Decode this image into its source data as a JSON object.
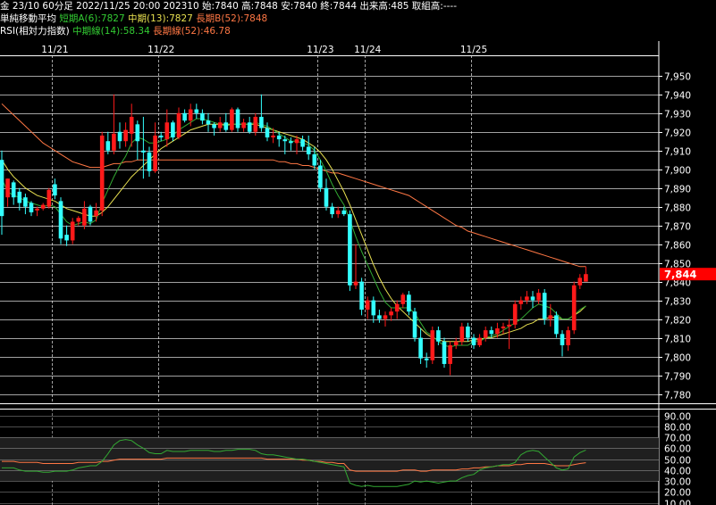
{
  "header": {
    "line1": "金 23/10 60分足 2022/11/25 20:00 202310 始:7840 高:7848 安:7840 終:7844 出来高:485 取組高:----",
    "line2_label": "単純移動平均",
    "line2_short": "短期A(6):7827",
    "line2_mid": "中期(13):7827",
    "line2_long": "長期B(52):7848",
    "line3_label": "RSI(相対力指数)",
    "line3_mid": "中期線(14):58.34",
    "line3_long": "長期線(52):46.78"
  },
  "colors": {
    "up": "#ff1a1a",
    "down": "#33ffff",
    "ma_short": "#33aa33",
    "ma_mid": "#e8e050",
    "ma_long": "#ff7744",
    "rsi_mid": "#33aa33",
    "rsi_long": "#ff7744",
    "last_price_bg": "#ff0000",
    "grid": "#ffffff"
  },
  "chart_data": {
    "type": "candlestick",
    "x_labels": [
      "11/21",
      "11/22",
      "11/23",
      "11/24",
      "11/25"
    ],
    "x_label_bars": [
      9,
      27,
      54,
      62,
      80
    ],
    "date_boundary_bars": [
      0,
      9,
      27,
      54,
      62,
      80
    ],
    "y_ticks": [
      7780,
      7790,
      7800,
      7810,
      7820,
      7830,
      7840,
      7850,
      7860,
      7870,
      7880,
      7890,
      7900,
      7910,
      7920,
      7930,
      7940,
      7950
    ],
    "y_tick_labels": [
      "7,780",
      "7,790",
      "7,800",
      "7,810",
      "7,820",
      "7,830",
      "7,840",
      "7,850",
      "7,860",
      "7,870",
      "7,880",
      "7,890",
      "7,900",
      "7,910",
      "7,920",
      "7,930",
      "7,940",
      "7,950"
    ],
    "ylim": [
      7775,
      7958
    ],
    "last_price": 7844,
    "last_price_label": "7,844",
    "candles": [
      [
        7905,
        7910,
        7865,
        7875
      ],
      [
        7885,
        7895,
        7880,
        7895
      ],
      [
        7893,
        7894,
        7881,
        7885
      ],
      [
        7888,
        7890,
        7878,
        7882
      ],
      [
        7885,
        7887,
        7876,
        7880
      ],
      [
        7882,
        7883,
        7875,
        7877
      ],
      [
        7878,
        7880,
        7875,
        7879
      ],
      [
        7879,
        7882,
        7878,
        7881
      ],
      [
        7880,
        7890,
        7879,
        7889
      ],
      [
        7892,
        7895,
        7884,
        7886
      ],
      [
        7883,
        7885,
        7860,
        7863
      ],
      [
        7865,
        7870,
        7859,
        7862
      ],
      [
        7862,
        7874,
        7860,
        7872
      ],
      [
        7872,
        7875,
        7870,
        7874
      ],
      [
        7870,
        7883,
        7868,
        7879
      ],
      [
        7880,
        7881,
        7870,
        7872
      ],
      [
        7875,
        7882,
        7872,
        7878
      ],
      [
        7878,
        7920,
        7875,
        7918
      ],
      [
        7915,
        7920,
        7908,
        7910
      ],
      [
        7910,
        7940,
        7908,
        7919
      ],
      [
        7920,
        7925,
        7911,
        7915
      ],
      [
        7915,
        7925,
        7912,
        7921
      ],
      [
        7919,
        7935,
        7912,
        7928
      ],
      [
        7924,
        7926,
        7905,
        7915
      ],
      [
        7910,
        7928,
        7895,
        7909
      ],
      [
        7909,
        7912,
        7896,
        7899
      ],
      [
        7899,
        7925,
        7898,
        7918
      ],
      [
        7918,
        7920,
        7915,
        7917
      ],
      [
        7916,
        7932,
        7912,
        7925
      ],
      [
        7925,
        7926,
        7915,
        7917
      ],
      [
        7917,
        7933,
        7916,
        7930
      ],
      [
        7930,
        7932,
        7925,
        7926
      ],
      [
        7926,
        7935,
        7923,
        7932
      ],
      [
        7932,
        7935,
        7927,
        7930
      ],
      [
        7930,
        7932,
        7924,
        7926
      ],
      [
        7926,
        7930,
        7920,
        7924
      ],
      [
        7924,
        7925,
        7918,
        7922
      ],
      [
        7922,
        7928,
        7920,
        7925
      ],
      [
        7925,
        7930,
        7920,
        7921
      ],
      [
        7921,
        7933,
        7920,
        7932
      ],
      [
        7932,
        7933,
        7920,
        7922
      ],
      [
        7922,
        7927,
        7920,
        7925
      ],
      [
        7925,
        7928,
        7919,
        7920
      ],
      [
        7920,
        7930,
        7918,
        7928
      ],
      [
        7928,
        7940,
        7920,
        7922
      ],
      [
        7922,
        7925,
        7915,
        7917
      ],
      [
        7917,
        7922,
        7914,
        7918
      ],
      [
        7918,
        7920,
        7912,
        7916
      ],
      [
        7916,
        7918,
        7908,
        7915
      ],
      [
        7915,
        7917,
        7910,
        7914
      ],
      [
        7914,
        7918,
        7908,
        7916
      ],
      [
        7916,
        7918,
        7910,
        7912
      ],
      [
        7912,
        7918,
        7905,
        7908
      ],
      [
        7908,
        7912,
        7900,
        7902
      ],
      [
        7902,
        7905,
        7888,
        7890
      ],
      [
        7890,
        7895,
        7878,
        7880
      ],
      [
        7880,
        7882,
        7874,
        7876
      ],
      [
        7876,
        7880,
        7874,
        7878
      ],
      [
        7878,
        7880,
        7875,
        7876
      ],
      [
        7876,
        7878,
        7835,
        7838
      ],
      [
        7838,
        7860,
        7836,
        7840
      ],
      [
        7840,
        7842,
        7822,
        7825
      ],
      [
        7825,
        7832,
        7820,
        7830
      ],
      [
        7830,
        7832,
        7818,
        7822
      ],
      [
        7822,
        7825,
        7818,
        7820
      ],
      [
        7820,
        7824,
        7816,
        7822
      ],
      [
        7822,
        7826,
        7819,
        7824
      ],
      [
        7824,
        7830,
        7820,
        7828
      ],
      [
        7828,
        7834,
        7826,
        7833
      ],
      [
        7833,
        7835,
        7822,
        7824
      ],
      [
        7824,
        7826,
        7808,
        7810
      ],
      [
        7810,
        7815,
        7796,
        7799
      ],
      [
        7799,
        7802,
        7794,
        7798
      ],
      [
        7798,
        7816,
        7796,
        7814
      ],
      [
        7814,
        7816,
        7806,
        7808
      ],
      [
        7808,
        7810,
        7794,
        7796
      ],
      [
        7796,
        7808,
        7790,
        7806
      ],
      [
        7806,
        7810,
        7804,
        7808
      ],
      [
        7808,
        7818,
        7806,
        7816
      ],
      [
        7816,
        7818,
        7808,
        7810
      ],
      [
        7810,
        7812,
        7804,
        7806
      ],
      [
        7806,
        7812,
        7805,
        7810
      ],
      [
        7810,
        7816,
        7808,
        7814
      ],
      [
        7814,
        7816,
        7810,
        7812
      ],
      [
        7812,
        7818,
        7810,
        7815
      ],
      [
        7815,
        7818,
        7812,
        7816
      ],
      [
        7816,
        7820,
        7804,
        7817
      ],
      [
        7817,
        7830,
        7815,
        7828
      ],
      [
        7828,
        7832,
        7825,
        7830
      ],
      [
        7830,
        7835,
        7828,
        7832
      ],
      [
        7832,
        7835,
        7826,
        7830
      ],
      [
        7830,
        7836,
        7828,
        7834
      ],
      [
        7834,
        7836,
        7817,
        7820
      ],
      [
        7820,
        7828,
        7816,
        7822
      ],
      [
        7822,
        7824,
        7810,
        7812
      ],
      [
        7812,
        7814,
        7800,
        7806
      ],
      [
        7806,
        7816,
        7803,
        7814
      ],
      [
        7814,
        7840,
        7812,
        7838
      ],
      [
        7838,
        7844,
        7836,
        7842
      ],
      [
        7840,
        7848,
        7840,
        7844
      ]
    ],
    "ma_short": [
      7895,
      7888,
      7886,
      7885,
      7883,
      7882,
      7881,
      7880,
      7881,
      7880,
      7876,
      7872,
      7870,
      7871,
      7872,
      7871,
      7873,
      7882,
      7889,
      7896,
      7902,
      7907,
      7914,
      7917,
      7916,
      7914,
      7914,
      7915,
      7916,
      7918,
      7921,
      7923,
      7925,
      7927,
      7927,
      7926,
      7925,
      7924,
      7923,
      7924,
      7924,
      7924,
      7924,
      7925,
      7924,
      7923,
      7921,
      7919,
      7917,
      7915,
      7915,
      7914,
      7913,
      7910,
      7905,
      7899,
      7892,
      7886,
      7881,
      7873,
      7864,
      7856,
      7849,
      7842,
      7835,
      7829,
      7826,
      7826,
      7826,
      7826,
      7823,
      7818,
      7813,
      7811,
      7808,
      7806,
      7805,
      7806,
      7806,
      7806,
      7808,
      7808,
      7810,
      7811,
      7812,
      7814,
      7816,
      7818,
      7820,
      7823,
      7826,
      7828,
      7827,
      7826,
      7823,
      7820,
      7820,
      7822,
      7825,
      7827
    ],
    "ma_mid": [
      7905,
      7900,
      7896,
      7893,
      7890,
      7888,
      7886,
      7885,
      7884,
      7883,
      7881,
      7879,
      7878,
      7877,
      7876,
      7875,
      7875,
      7877,
      7880,
      7884,
      7888,
      7892,
      7896,
      7899,
      7902,
      7905,
      7908,
      7911,
      7913,
      7915,
      7917,
      7919,
      7921,
      7922,
      7923,
      7924,
      7924,
      7924,
      7924,
      7924,
      7924,
      7924,
      7924,
      7924,
      7923,
      7922,
      7921,
      7920,
      7919,
      7918,
      7917,
      7916,
      7914,
      7912,
      7909,
      7905,
      7900,
      7894,
      7888,
      7881,
      7873,
      7865,
      7857,
      7849,
      7842,
      7836,
      7831,
      7827,
      7824,
      7821,
      7818,
      7815,
      7812,
      7810,
      7809,
      7808,
      7808,
      7808,
      7808,
      7808,
      7809,
      7809,
      7810,
      7810,
      7811,
      7812,
      7813,
      7814,
      7815,
      7817,
      7818,
      7820,
      7820,
      7821,
      7821,
      7820,
      7820,
      7822,
      7824,
      7827
    ],
    "ma_long": [
      7935,
      7932,
      7929,
      7926,
      7923,
      7920,
      7917,
      7914,
      7912,
      7910,
      7908,
      7906,
      7904,
      7903,
      7902,
      7901,
      7901,
      7901,
      7902,
      7903,
      7903,
      7904,
      7904,
      7905,
      7905,
      7905,
      7905,
      7905,
      7905,
      7905,
      7905,
      7905,
      7905,
      7905,
      7905,
      7905,
      7905,
      7905,
      7905,
      7905,
      7905,
      7905,
      7905,
      7905,
      7905,
      7905,
      7905,
      7904,
      7904,
      7903,
      7903,
      7902,
      7902,
      7901,
      7900,
      7899,
      7898,
      7898,
      7897,
      7896,
      7895,
      7894,
      7893,
      7892,
      7891,
      7890,
      7889,
      7888,
      7887,
      7886,
      7884,
      7882,
      7880,
      7878,
      7876,
      7874,
      7872,
      7870,
      7869,
      7867,
      7866,
      7865,
      7864,
      7863,
      7862,
      7861,
      7860,
      7859,
      7858,
      7857,
      7856,
      7855,
      7854,
      7853,
      7852,
      7851,
      7850,
      7849,
      7848,
      7848
    ],
    "rsi": {
      "y_ticks": [
        10,
        20,
        30,
        40,
        50,
        60,
        70,
        80,
        90
      ],
      "y_tick_labels": [
        "10.00",
        "20.00",
        "30.00",
        "40.00",
        "50.00",
        "60.00",
        "70.00",
        "80.00",
        "90.00"
      ],
      "ylim": [
        8,
        93
      ],
      "band_lower": 30,
      "band_upper": 70,
      "mid": [
        42,
        42,
        42,
        40,
        39,
        39,
        39,
        38,
        38,
        39,
        39,
        39,
        40,
        42,
        43,
        44,
        44,
        48,
        55,
        63,
        67,
        68,
        67,
        63,
        60,
        56,
        55,
        55,
        58,
        57,
        57,
        57,
        58,
        58,
        58,
        58,
        57,
        57,
        58,
        58,
        59,
        59,
        59,
        58,
        55,
        54,
        54,
        53,
        52,
        51,
        50,
        50,
        49,
        48,
        47,
        46,
        45,
        44,
        43,
        28,
        26,
        25,
        26,
        25,
        25,
        25,
        25,
        25,
        26,
        27,
        30,
        29,
        30,
        29,
        28,
        29,
        30,
        30,
        33,
        35,
        36,
        40,
        42,
        43,
        44,
        45,
        45,
        47,
        54,
        57,
        58,
        57,
        52,
        47,
        42,
        40,
        41,
        52,
        56,
        58.34
      ],
      "long": [
        48,
        48,
        48,
        47,
        47,
        47,
        47,
        46,
        46,
        46,
        46,
        46,
        46,
        47,
        47,
        47,
        47,
        48,
        48,
        49,
        50,
        50,
        50,
        50,
        50,
        50,
        50,
        50,
        51,
        51,
        51,
        51,
        51,
        51,
        51,
        51,
        51,
        51,
        51,
        51,
        51,
        51,
        51,
        51,
        51,
        50,
        50,
        50,
        50,
        50,
        50,
        49,
        49,
        48,
        48,
        47,
        47,
        46,
        46,
        40,
        39,
        39,
        39,
        39,
        39,
        39,
        39,
        39,
        40,
        40,
        40,
        39,
        39,
        40,
        40,
        40,
        40,
        40,
        41,
        41,
        42,
        42,
        43,
        43,
        44,
        44,
        44,
        45,
        45,
        46,
        46,
        46,
        46,
        45,
        44,
        44,
        44,
        45,
        46,
        46.78
      ]
    }
  }
}
